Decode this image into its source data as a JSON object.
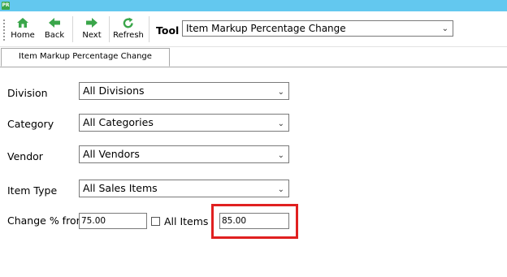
{
  "app": {
    "logo_text": "PR"
  },
  "toolbar": {
    "buttons": [
      {
        "label": "Home",
        "icon": "home-icon"
      },
      {
        "label": "Back",
        "icon": "back-arrow-icon"
      },
      {
        "label": "Next",
        "icon": "next-arrow-icon"
      },
      {
        "label": "Refresh",
        "icon": "refresh-icon"
      }
    ],
    "tool_label": "Tool",
    "tool_value": "Item Markup Percentage Change"
  },
  "tab": {
    "label": "Item Markup Percentage Change"
  },
  "form": {
    "division": {
      "label": "Division",
      "value": "All Divisions"
    },
    "category": {
      "label": "Category",
      "value": "All Categories"
    },
    "vendor": {
      "label": "Vendor",
      "value": "All Vendors"
    },
    "item_type": {
      "label": "Item Type",
      "value": "All Sales Items"
    },
    "change": {
      "label": "Change % from",
      "from_value": "75.00",
      "all_items_label": "All Items",
      "all_items_checked": false,
      "to_value": "85.00"
    }
  },
  "colors": {
    "titlebar": "#63c8ef",
    "highlight": "#e02020",
    "icon_green": "#3aa64a"
  }
}
